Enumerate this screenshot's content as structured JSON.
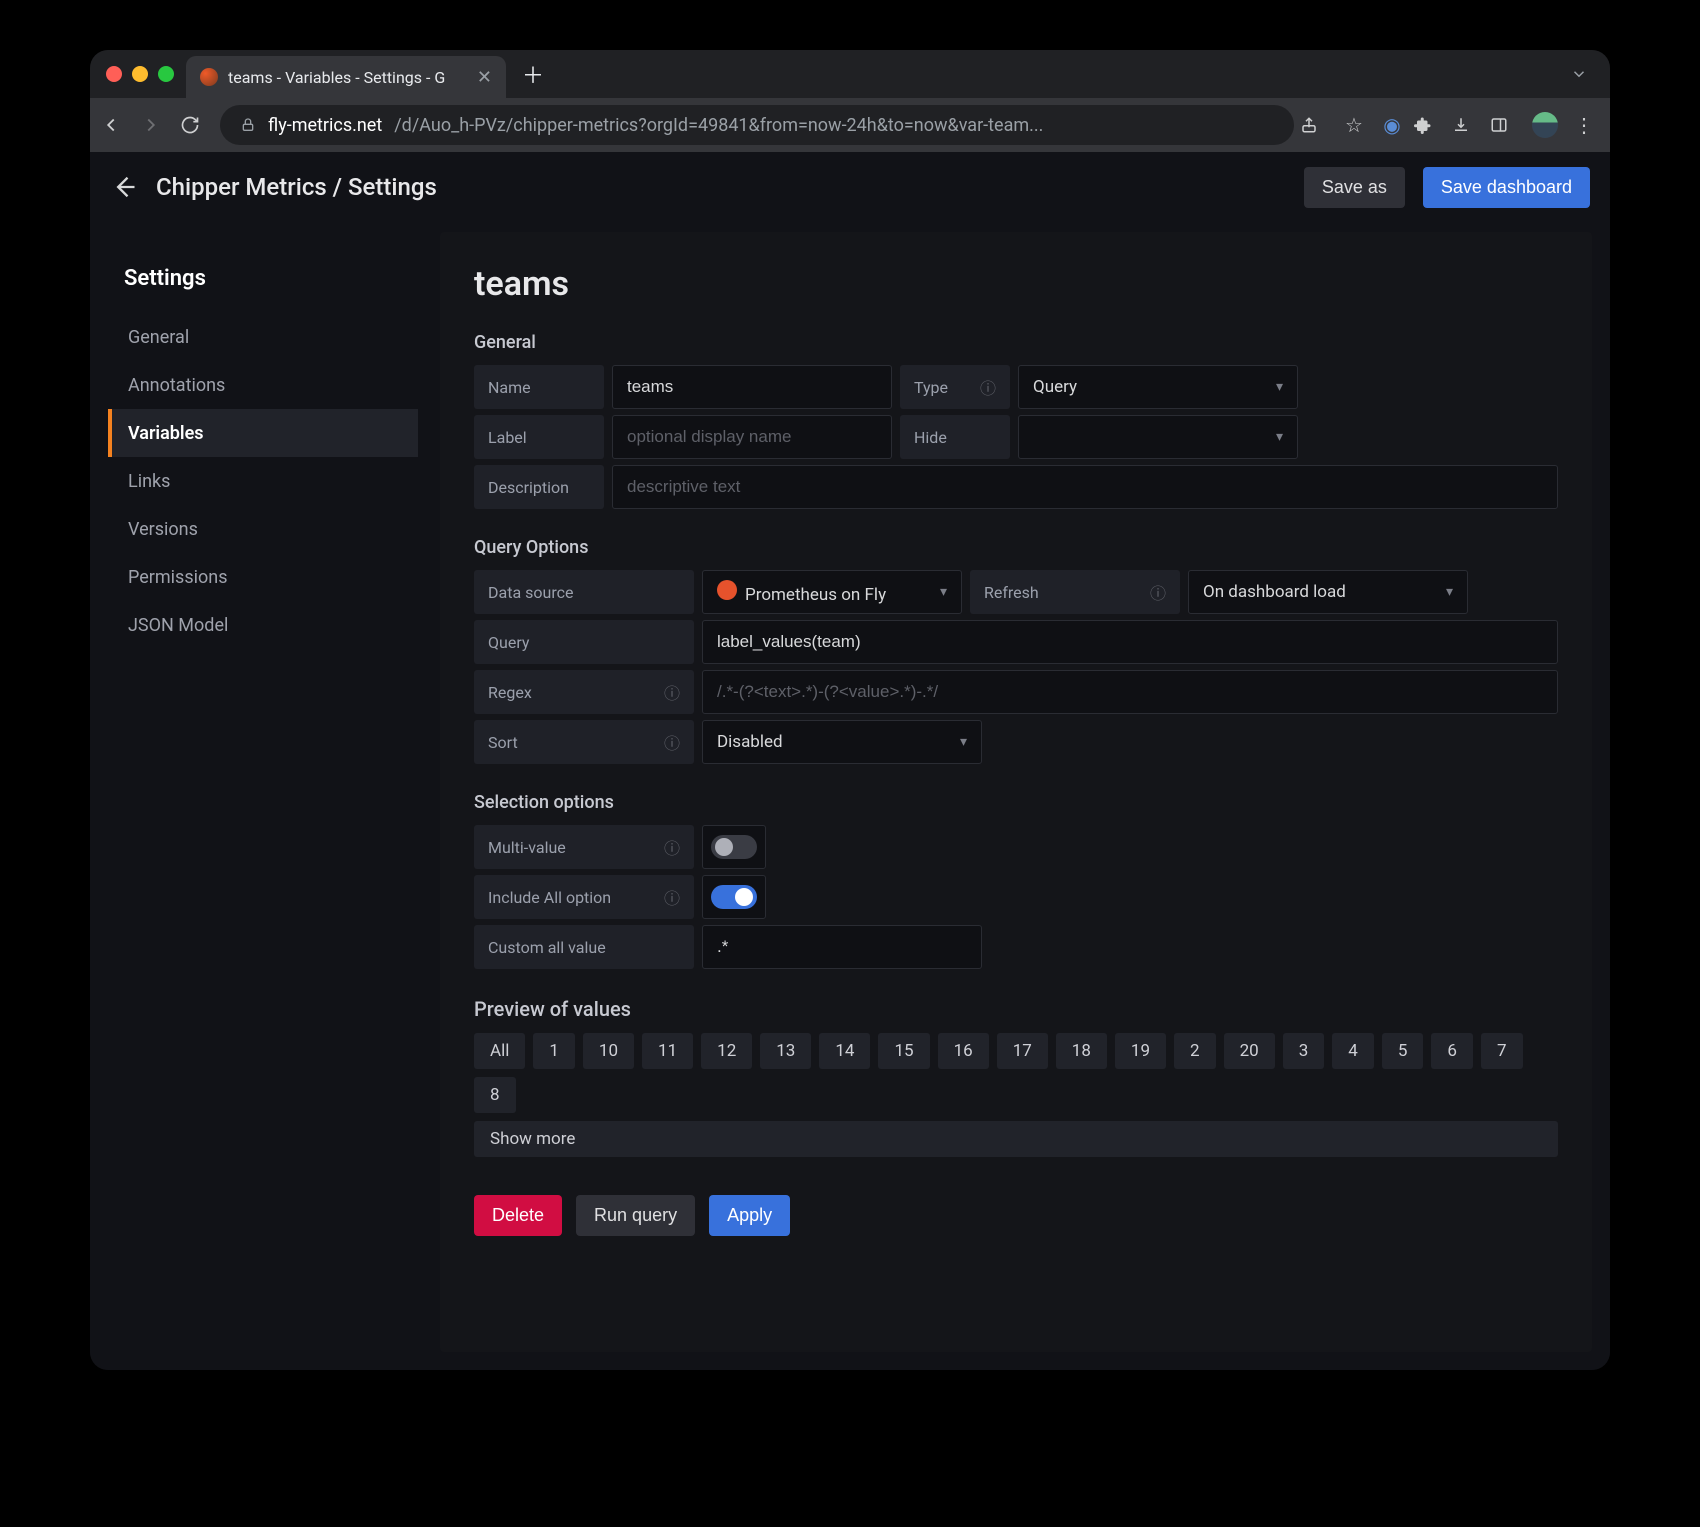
{
  "browser": {
    "tab_title": "teams - Variables - Settings - G",
    "url_domain": "fly-metrics.net",
    "url_path": "/d/Auo_h-PVz/chipper-metrics?orgId=49841&from=now-24h&to=now&var-team..."
  },
  "header": {
    "breadcrumb": "Chipper Metrics / Settings",
    "save_as": "Save as",
    "save_dashboard": "Save dashboard"
  },
  "sidebar": {
    "title": "Settings",
    "items": [
      {
        "label": "General"
      },
      {
        "label": "Annotations"
      },
      {
        "label": "Variables"
      },
      {
        "label": "Links"
      },
      {
        "label": "Versions"
      },
      {
        "label": "Permissions"
      },
      {
        "label": "JSON Model"
      }
    ],
    "active_index": 2
  },
  "page": {
    "title": "teams",
    "sections": {
      "general": {
        "title": "General",
        "name_label": "Name",
        "name_value": "teams",
        "type_label": "Type",
        "type_value": "Query",
        "label_label": "Label",
        "label_placeholder": "optional display name",
        "hide_label": "Hide",
        "hide_value": "",
        "desc_label": "Description",
        "desc_placeholder": "descriptive text"
      },
      "query": {
        "title": "Query Options",
        "datasource_label": "Data source",
        "datasource_value": "Prometheus on Fly",
        "refresh_label": "Refresh",
        "refresh_value": "On dashboard load",
        "query_label": "Query",
        "query_value": "label_values(team)",
        "regex_label": "Regex",
        "regex_placeholder": "/.*-(?<text>.*)-(?<value>.*)-.*/",
        "sort_label": "Sort",
        "sort_value": "Disabled"
      },
      "selection": {
        "title": "Selection options",
        "multi_label": "Multi-value",
        "include_all_label": "Include All option",
        "custom_all_label": "Custom all value",
        "custom_all_value": ".*",
        "multi_on": false,
        "include_all_on": true
      },
      "preview": {
        "title": "Preview of values",
        "values": [
          "All",
          "1",
          "10",
          "11",
          "12",
          "13",
          "14",
          "15",
          "16",
          "17",
          "18",
          "19",
          "2",
          "20",
          "3",
          "4",
          "5",
          "6",
          "7",
          "8"
        ],
        "show_more": "Show more"
      }
    },
    "footer": {
      "delete": "Delete",
      "run_query": "Run query",
      "apply": "Apply"
    }
  }
}
